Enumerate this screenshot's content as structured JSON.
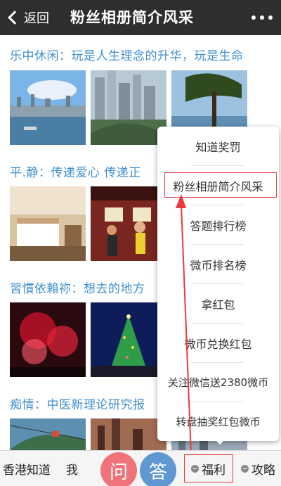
{
  "header": {
    "back_label": "返回",
    "title": "粉丝相册简介风采"
  },
  "posts": [
    {
      "title": "乐中休闲：玩是人生理念的升华，玩是生命"
    },
    {
      "title": "平.静：传递爱心 传递正"
    },
    {
      "title": "習慣依賴祢：想去的地方"
    },
    {
      "title": "痴情：中医新理论研究报"
    }
  ],
  "menu": {
    "items": [
      "知道奖罚",
      "粉丝相册简介风采",
      "答题排行榜",
      "微币排名榜",
      "拿红包",
      "微币兑换红包",
      "关注微信送2380微币",
      "转盘抽奖红包微币"
    ]
  },
  "bottom_bar": {
    "tab_hk": "香港知道",
    "tab_me": "我",
    "ask": "问",
    "answer": "答",
    "fuli": "福利",
    "gonglue": "攻略"
  },
  "colors": {
    "header_bg": "#2e2e31",
    "link_blue": "#3f8fcf",
    "ask_red": "#f0737a",
    "answer_blue": "#5f97d3",
    "annotation_red": "#e83a3a"
  }
}
